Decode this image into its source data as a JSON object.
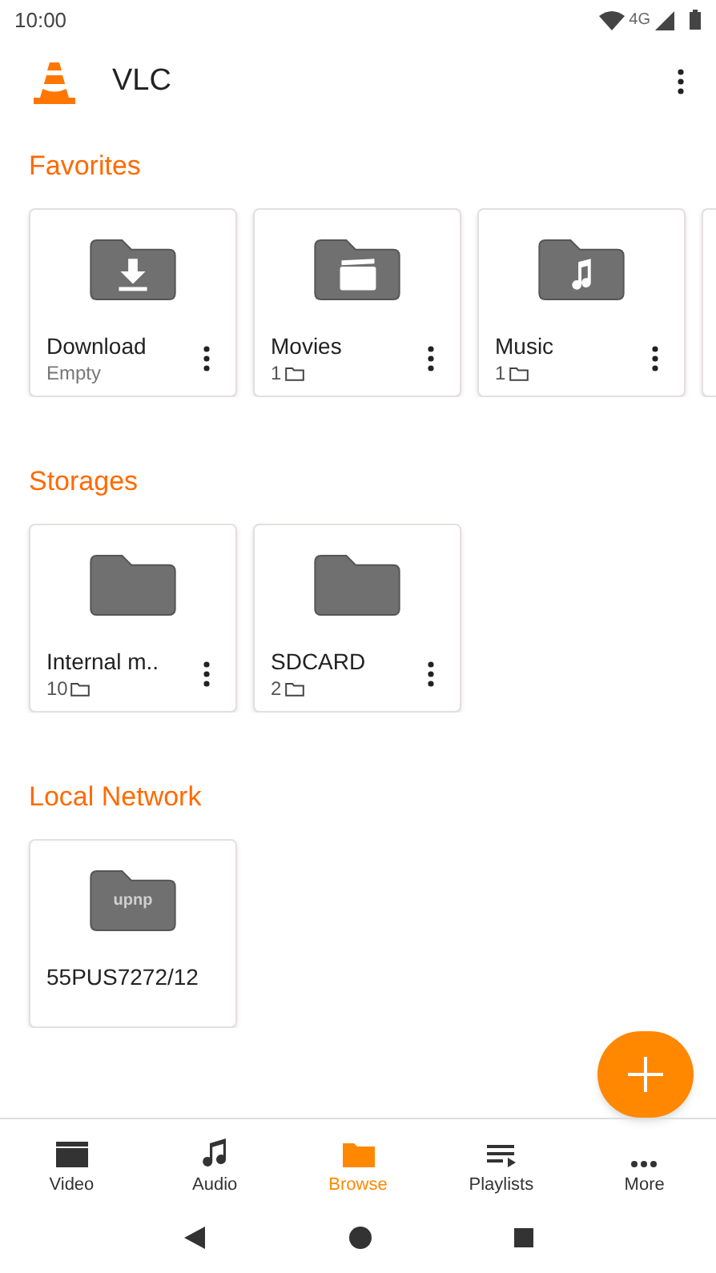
{
  "status_bar": {
    "time": "10:00",
    "network": "4G"
  },
  "app_bar": {
    "title": "VLC"
  },
  "sections": [
    {
      "title": "Favorites",
      "cards": [
        {
          "kind": "download",
          "name": "Download",
          "subtitle": {
            "kind": "text",
            "text": "Empty"
          },
          "menu": true
        },
        {
          "kind": "movies",
          "name": "Movies",
          "subtitle": {
            "kind": "count",
            "text": "1"
          },
          "menu": true
        },
        {
          "kind": "music",
          "name": "Music",
          "subtitle": {
            "kind": "count",
            "text": "1"
          },
          "menu": true
        },
        {
          "kind": "partial"
        }
      ]
    },
    {
      "title": "Storages",
      "cards": [
        {
          "kind": "folder",
          "name": "Internal m..",
          "subtitle": {
            "kind": "count",
            "text": "10"
          },
          "menu": true
        },
        {
          "kind": "folder",
          "name": "SDCARD",
          "subtitle": {
            "kind": "count",
            "text": "2"
          },
          "menu": true
        }
      ]
    },
    {
      "title": "Local Network",
      "cards": [
        {
          "kind": "upnp",
          "icon_label": "upnp",
          "name": "55PUS7272/12",
          "menu": false
        }
      ]
    }
  ],
  "bottom_nav": [
    {
      "label": "Video",
      "selected": false
    },
    {
      "label": "Audio",
      "selected": false
    },
    {
      "label": "Browse",
      "selected": true
    },
    {
      "label": "Playlists",
      "selected": false
    },
    {
      "label": "More",
      "selected": false
    }
  ]
}
